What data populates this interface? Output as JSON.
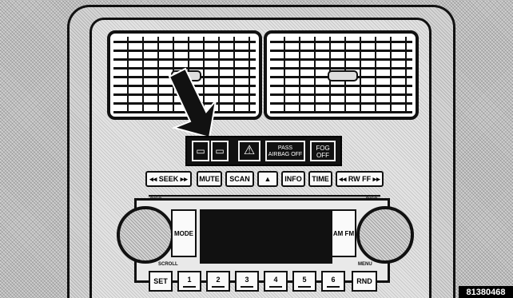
{
  "figure": {
    "number": "81380468"
  },
  "switch_bank": {
    "rear_defrost_symbol": "▭",
    "front_defrost_symbol": "▭",
    "hazard_symbol": "⚠",
    "airbag_label": "PASS AIRBAG OFF",
    "fog_label": "FOG OFF"
  },
  "radio": {
    "buttons_top": [
      "◂◂ SEEK ▸▸",
      "MUTE",
      "SCAN",
      "▲",
      "INFO",
      "TIME",
      "◂◂ RW FF ▸▸"
    ],
    "mode_label": "MODE",
    "am_fm_label": "AM FM",
    "set_label": "SET",
    "rnd_label": "RND",
    "presets": [
      "1",
      "2",
      "3",
      "4",
      "5",
      "6"
    ],
    "disc_label": "DISC",
    "eject_label": "DISC",
    "scroll_label": "SCROLL",
    "menu_label": "MENU"
  }
}
